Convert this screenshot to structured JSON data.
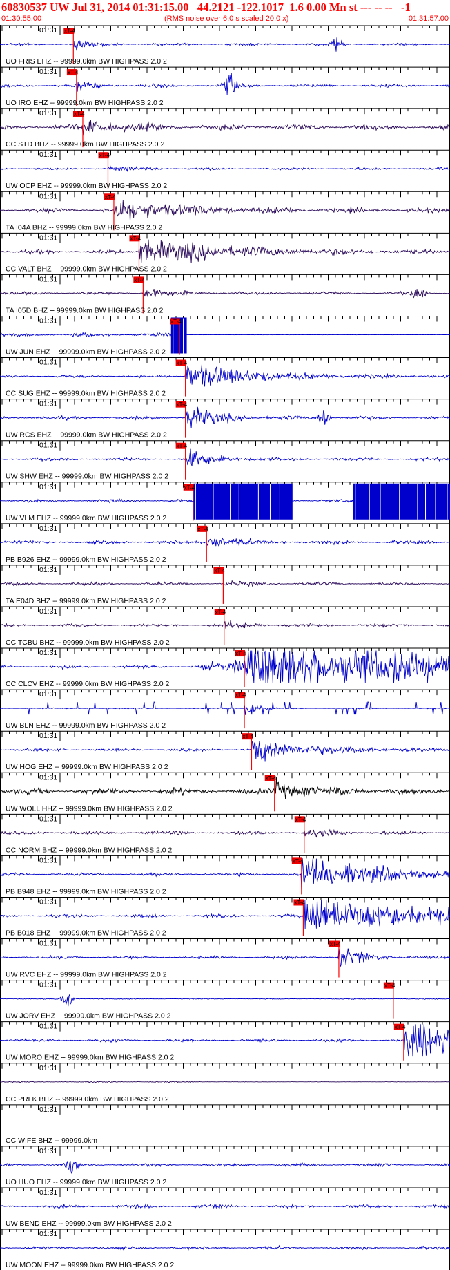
{
  "header": {
    "title": "60830537 UW Jul 31, 2014 01:31:15.00   44.2121 -122.1017  1.6 0.00 Mn st --- -- --   -1",
    "start_time": "01:30:55.00",
    "rms_note": "(RMS noise over 6.0 s scaled 20.0 x)",
    "end_time": "01:31:57.00",
    "text_color": "#ff0000"
  },
  "chart_data": {
    "type": "line",
    "title": "60830537 UW Jul 31, 2014 01:31:15.00",
    "x_axis": {
      "start": "01:30:55.00",
      "end": "01:31:57.00",
      "tick_label": "01:31"
    },
    "pick_label": "xT-4",
    "colors": {
      "blue": "#0000cc",
      "purple": "#2a0a5a",
      "black": "#000000",
      "pick": "#ff0000",
      "box": "#ee0000"
    },
    "traces": [
      {
        "label": "UO FRIS EHZ -- 99999.0km BW  HIGHPASS  2.0  2",
        "color": "blue",
        "pick": 0.163,
        "amp": 0.25,
        "noise": 0.1,
        "burst_at": 0.75,
        "burst_amp": 0.7,
        "event_amp": 0.5,
        "event_decay": 0.03
      },
      {
        "label": "UO IRO EHZ -- 99999.0km BW  HIGHPASS  2.0  2",
        "color": "blue",
        "pick": 0.17,
        "amp": 0.35,
        "noise": 0.14,
        "burst_at": 0.51,
        "burst_amp": 0.9,
        "event_amp": 0.4,
        "event_decay": 0.03
      },
      {
        "label": "CC STD BHZ -- 99999.0km BW  HIGHPASS  2.0  2",
        "color": "purple",
        "pick": 0.184,
        "amp": 0.25,
        "noise": 0.22,
        "event_amp": 0.5,
        "event_decay": 0.08
      },
      {
        "label": "UW OCP EHZ -- 99999.0km BW  HIGHPASS  2.0  2",
        "color": "blue",
        "pick": 0.24,
        "amp": 0.2,
        "noise": 0.1,
        "event_amp": 0.2,
        "event_decay": 0.05
      },
      {
        "label": "TA I04A BHZ -- 99999.0km BW  HIGHPASS  2.0  2",
        "color": "purple",
        "pick": 0.253,
        "amp": 0.4,
        "noise": 0.18,
        "event_amp": 0.8,
        "event_decay": 0.15
      },
      {
        "label": "CC VALT BHZ -- 99999.0km BW  HIGHPASS  2.0  2",
        "color": "purple",
        "pick": 0.309,
        "amp": 0.35,
        "noise": 0.15,
        "event_amp": 0.9,
        "event_decay": 0.2
      },
      {
        "label": "TA I05D BHZ -- 99999.0km BW  HIGHPASS  2.0  2",
        "color": "purple",
        "pick": 0.318,
        "amp": 0.35,
        "noise": 0.12,
        "burst_at": 0.93,
        "burst_amp": 0.8,
        "event_amp": 0.4,
        "event_decay": 0.05
      },
      {
        "label": "UW JUN EHZ -- 99999.0km BW  HIGHPASS  2.0  2",
        "color": "blue",
        "pick": 0.399,
        "amp": 0.3,
        "noise": 0.15,
        "saturate": [
          0.38,
          0.415
        ],
        "quiet_after": 0.415,
        "event_amp": 0,
        "event_decay": 0.01
      },
      {
        "label": "CC SUG EHZ -- 99999.0km BW  HIGHPASS  2.0  2",
        "color": "blue",
        "pick": 0.412,
        "amp": 0.3,
        "noise": 0.1,
        "event_amp": 1.0,
        "event_decay": 0.15
      },
      {
        "label": "UW RCS EHZ -- 99999.0km BW  HIGHPASS  2.0  2",
        "color": "blue",
        "pick": 0.412,
        "amp": 0.35,
        "noise": 0.14,
        "burst_at": 0.72,
        "burst_amp": 0.9,
        "event_amp": 1.0,
        "event_decay": 0.06
      },
      {
        "label": "UW SHW EHZ -- 99999.0km BW  HIGHPASS  2.0  2",
        "color": "blue",
        "pick": 0.412,
        "amp": 0.3,
        "noise": 0.12,
        "event_amp": 0.8,
        "event_decay": 0.05
      },
      {
        "label": "UW VLM EHZ -- 99999.0km BW  HIGHPASS  2.0  2",
        "color": "blue",
        "pick": 0.429,
        "amp": 0.3,
        "noise": 0.12,
        "saturate": [
          0.43,
          0.65
        ],
        "saturate2": [
          0.785,
          1.0
        ],
        "event_amp": 0,
        "event_decay": 0.01
      },
      {
        "label": "PB B926 EHZ -- 99999.0km BW  HIGHPASS  2.0  2",
        "color": "blue",
        "pick": 0.459,
        "amp": 0.3,
        "noise": 0.15,
        "event_amp": 0.6,
        "event_decay": 0.05
      },
      {
        "label": "TA E04D BHZ -- 99999.0km BW  HIGHPASS  2.0  2",
        "color": "purple",
        "pick": 0.496,
        "amp": 0.25,
        "noise": 0.12,
        "event_amp": 0.15,
        "event_decay": 0.05
      },
      {
        "label": "CC TCBU BHZ -- 99999.0km BW  HIGHPASS  2.0  2",
        "color": "purple",
        "pick": 0.498,
        "amp": 0.25,
        "noise": 0.12,
        "event_amp": 0.25,
        "event_decay": 0.05
      },
      {
        "label": "CC CLCV EHZ -- 99999.0km BW  HIGHPASS  2.0  2",
        "color": "blue",
        "pick": 0.543,
        "amp": 0.3,
        "noise": 0.12,
        "event_amp": 2.0,
        "event_decay": 0.6,
        "pre_event_at": 0.43
      },
      {
        "label": "UW BLN EHZ -- 99999.0km BW  HIGHPASS  2.0  2",
        "color": "blue",
        "pick": 0.543,
        "amp": 0.15,
        "noise": 0.04,
        "spikes": true,
        "event_amp": 0.9,
        "event_decay": 0.02
      },
      {
        "label": "UW HOG EHZ -- 99999.0km BW  HIGHPASS  2.0  2",
        "color": "blue",
        "pick": 0.559,
        "amp": 0.3,
        "noise": 0.12,
        "event_amp": 0.9,
        "event_decay": 0.12
      },
      {
        "label": "UW WOLL HHZ -- 99999.0km BW  HIGHPASS  2.0  2",
        "color": "black",
        "pick": 0.61,
        "amp": 0.3,
        "noise": 0.25,
        "event_amp": 0.6,
        "event_decay": 0.08
      },
      {
        "label": "CC NORM BHZ -- 99999.0km BW  HIGHPASS  2.0  2",
        "color": "purple",
        "pick": 0.676,
        "amp": 0.25,
        "noise": 0.15,
        "event_amp": 0.3,
        "event_decay": 0.05
      },
      {
        "label": "PB B948 EHZ -- 99999.0km BW  HIGHPASS  2.0  2",
        "color": "blue",
        "pick": 0.67,
        "amp": 0.35,
        "noise": 0.12,
        "event_amp": 1.4,
        "event_decay": 0.15
      },
      {
        "label": "PB B018 EHZ -- 99999.0km BW  HIGHPASS  2.0  2",
        "color": "blue",
        "pick": 0.674,
        "amp": 0.35,
        "noise": 0.13,
        "event_amp": 1.6,
        "event_decay": 0.25
      },
      {
        "label": "UW RVC EHZ -- 99999.0km BW  HIGHPASS  2.0  2",
        "color": "blue",
        "pick": 0.753,
        "amp": 0.3,
        "noise": 0.12,
        "event_amp": 0.8,
        "event_decay": 0.05
      },
      {
        "label": "UW JORV EHZ -- 99999.0km BW  HIGHPASS  2.0  2",
        "color": "blue",
        "pick": 0.874,
        "amp": 0.25,
        "noise": 0.04,
        "burst_at": 0.15,
        "burst_amp": 0.6,
        "event_amp": 0,
        "event_decay": 0.01
      },
      {
        "label": "UW MORO EHZ -- 99999.0km BW  HIGHPASS  2.0  2",
        "color": "blue",
        "pick": 0.897,
        "amp": 0.35,
        "noise": 0.12,
        "event_amp": 1.5,
        "event_decay": 0.2
      },
      {
        "label": "CC PRLK BHZ -- 99999.0km BW  HIGHPASS  2.0  2",
        "color": "purple",
        "amp": 0.25,
        "noise": 0.05,
        "partial_end": 0.45
      },
      {
        "label": "CC WIFE BHZ -- 99999.0km",
        "color": "blue",
        "amp": 0,
        "noise": 0,
        "empty": true
      },
      {
        "label": "UO HUO EHZ -- 99999.0km BW  HIGHPASS  2.0  2",
        "color": "blue",
        "amp": 0.3,
        "noise": 0.12,
        "burst_at": 0.16,
        "burst_amp": 0.7
      },
      {
        "label": "UW BEND EHZ -- 99999.0km BW  HIGHPASS  2.0  2",
        "color": "blue",
        "amp": 0.3,
        "noise": 0.14
      },
      {
        "label": "UW MOON EHZ -- 99999.0km BW  HIGHPASS  2.0  2",
        "color": "blue",
        "amp": 0.3,
        "noise": 0.12
      }
    ]
  }
}
